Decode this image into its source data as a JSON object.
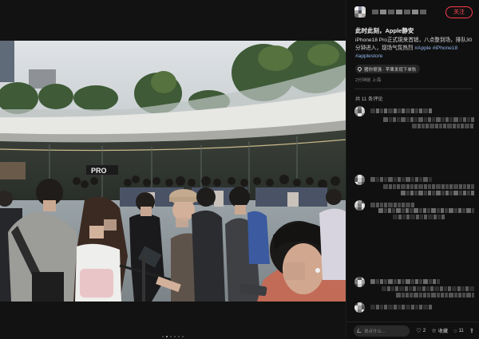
{
  "post": {
    "author_avatar_colors": [
      "#f0f0f0",
      "#8a93a6",
      "#d7d7d7",
      "#a3a3a3",
      "#4d4d4d",
      "#e8e8e8",
      "#6e6e6e",
      "#c9c9c9",
      "#b0a7a4"
    ],
    "author_name_blocks": 7,
    "follow_label": "关注",
    "title": "此时此刻，Apple静安",
    "body_text": "iPhone18 Pro正式現来首销，八点整到场，排队30分钟进入，现场气氛热烈",
    "hashtags": "#Apple #iPhone18 #applestore",
    "location_label": "猪你很强 · 苹果发现下单秋",
    "meta": "2分钟前 上海",
    "comment_count": "共 11 条评论"
  },
  "comments": {
    "blurred_comment_count": 5
  },
  "footer": {
    "input_placeholder": "说点什么...",
    "like_count": "2",
    "favorite_label": "收藏",
    "comments_count": "11",
    "share_icon": "share-icon"
  },
  "pager": {
    "total": 6,
    "active": 1
  },
  "colors": {
    "accent": "#ff3b4c",
    "hashtag": "#8fb6e8",
    "panel_bg": "#101010"
  }
}
